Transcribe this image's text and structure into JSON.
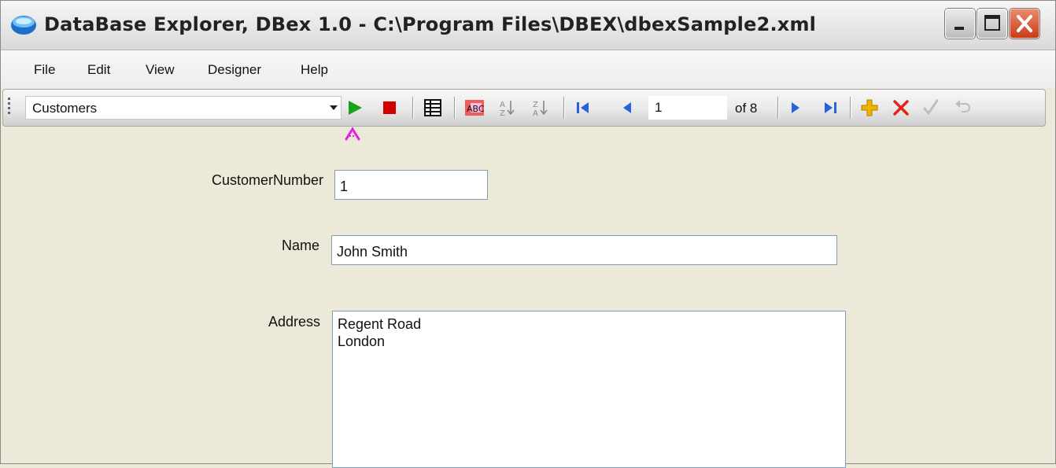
{
  "window": {
    "title": "DataBase Explorer, DBex 1.0  - C:\\Program Files\\DBEX\\dbexSample2.xml"
  },
  "menu": {
    "items": [
      "File",
      "Edit",
      "View",
      "Designer",
      "Help"
    ]
  },
  "toolbar": {
    "table_select_value": "Customers",
    "record_position_value": "1",
    "record_count_label": "of 8",
    "accent_colors": {
      "run": "#1aa31a",
      "stop": "#d40000",
      "nav": "#2a62d8",
      "add": "#f2b200",
      "delete": "#e8211c",
      "cursor_marker": "#e21ee8"
    }
  },
  "form": {
    "customer_number_label": "CustomerNumber",
    "customer_number_value": "1",
    "name_label": "Name",
    "name_value": "John Smith",
    "address_label": "Address",
    "address_value": "Regent Road\nLondon"
  }
}
